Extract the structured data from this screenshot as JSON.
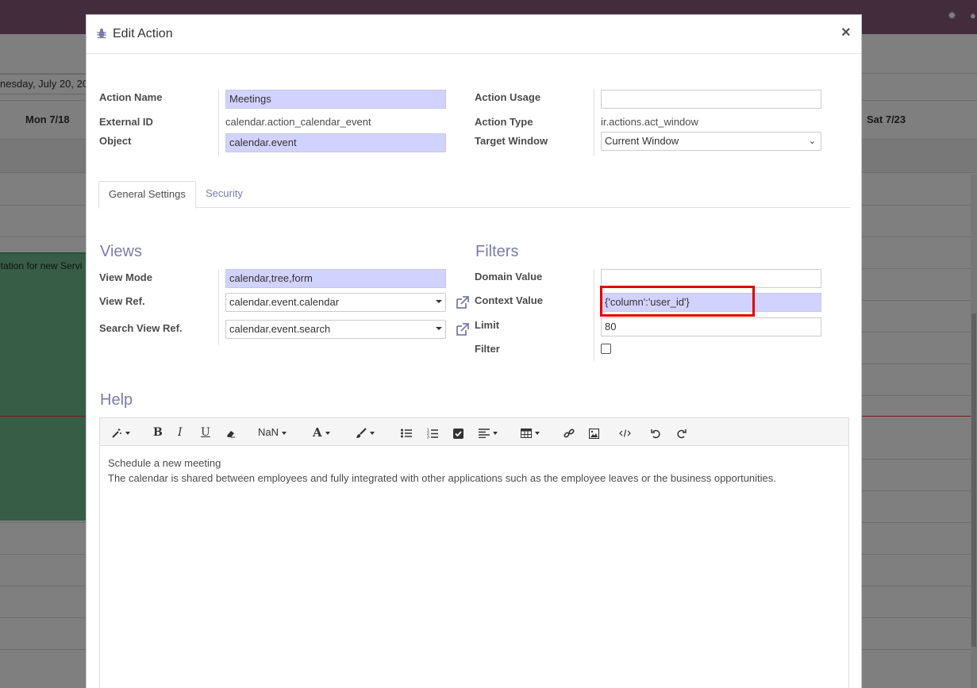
{
  "background": {
    "date_label": "nesday, July 20, 20",
    "days": [
      "Mon 7/18",
      "Sat 7/23"
    ],
    "event_text": "ntation for new Servi"
  },
  "modal": {
    "title": "Edit Action",
    "close": "×"
  },
  "fields_left": {
    "action_name_label": "Action Name",
    "action_name_value": "Meetings",
    "external_id_label": "External ID",
    "external_id_value": "calendar.action_calendar_event",
    "object_label": "Object",
    "object_value": "calendar.event"
  },
  "fields_right": {
    "action_usage_label": "Action Usage",
    "action_usage_value": "",
    "action_type_label": "Action Type",
    "action_type_value": "ir.actions.act_window",
    "target_window_label": "Target Window",
    "target_window_value": "Current Window"
  },
  "tabs": [
    "General Settings",
    "Security"
  ],
  "views": {
    "heading": "Views",
    "view_mode_label": "View Mode",
    "view_mode_value": "calendar,tree,form",
    "view_ref_label": "View Ref.",
    "view_ref_value": "calendar.event.calendar",
    "search_view_ref_label": "Search View Ref.",
    "search_view_ref_value": "calendar.event.search"
  },
  "filters": {
    "heading": "Filters",
    "domain_value_label": "Domain Value",
    "domain_value": "",
    "context_value_label": "Context Value",
    "context_value": "{'column':'user_id'}",
    "limit_label": "Limit",
    "limit_value": "80",
    "filter_label": "Filter",
    "filter_checked": false
  },
  "help": {
    "heading": "Help",
    "font_size": "NaN",
    "line1": "Schedule a new meeting",
    "line2": "The calendar is shared between employees and fully integrated with other applications such as the employee leaves or the business opportunities."
  },
  "colors": {
    "accent": "#7c7bad",
    "required_bg": "#d2d2ff",
    "highlight": "#e30000",
    "topbar": "#875a7b"
  }
}
